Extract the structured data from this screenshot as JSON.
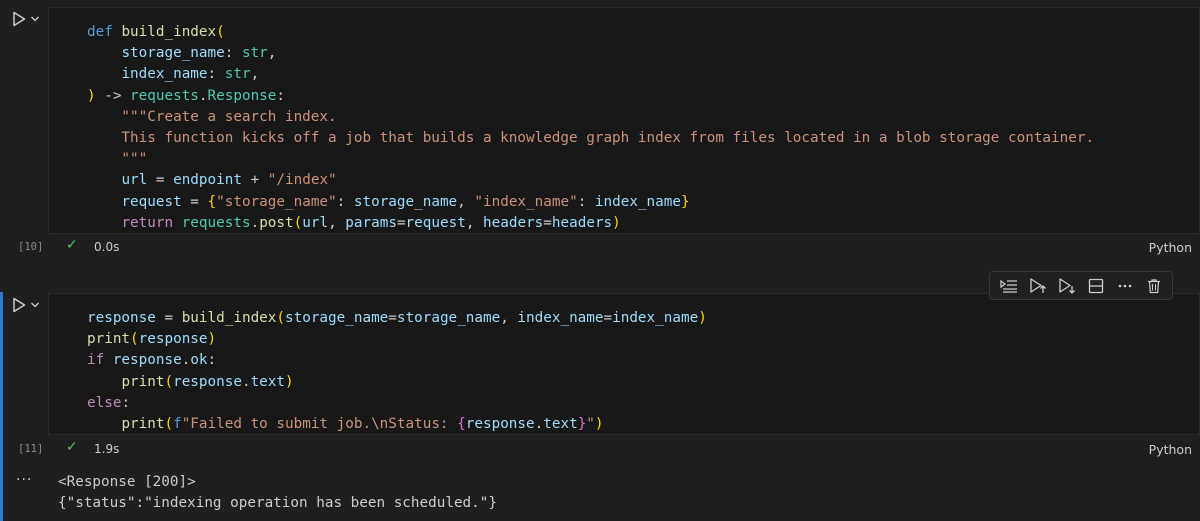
{
  "theme": {
    "background": "#1f1f1f",
    "editor_background": "#181818",
    "active_bar": "#2f7bd8",
    "success": "#4ec94e"
  },
  "cells": [
    {
      "execution_count": "[10]",
      "status_icon": "check-icon",
      "duration": "0.0s",
      "language": "Python",
      "code_lines": [
        [
          {
            "t": "def",
            "c": "kw"
          },
          {
            "t": " ",
            "c": "op"
          },
          {
            "t": "build_index",
            "c": "fn"
          },
          {
            "t": "(",
            "c": "p1"
          }
        ],
        [
          {
            "t": "    ",
            "c": "op"
          },
          {
            "t": "storage_name",
            "c": "var"
          },
          {
            "t": ": ",
            "c": "op"
          },
          {
            "t": "str",
            "c": "typ"
          },
          {
            "t": ",",
            "c": "op"
          }
        ],
        [
          {
            "t": "    ",
            "c": "op"
          },
          {
            "t": "index_name",
            "c": "var"
          },
          {
            "t": ": ",
            "c": "op"
          },
          {
            "t": "str",
            "c": "typ"
          },
          {
            "t": ",",
            "c": "op"
          }
        ],
        [
          {
            "t": ")",
            "c": "p1"
          },
          {
            "t": " -> ",
            "c": "op"
          },
          {
            "t": "requests",
            "c": "typ"
          },
          {
            "t": ".",
            "c": "op"
          },
          {
            "t": "Response",
            "c": "typ"
          },
          {
            "t": ":",
            "c": "op"
          }
        ],
        [
          {
            "t": "    \"\"\"Create a search index.",
            "c": "str"
          }
        ],
        [
          {
            "t": "    This function kicks off a job that builds a knowledge graph index from files located in a blob storage container.",
            "c": "str"
          }
        ],
        [
          {
            "t": "    \"\"\"",
            "c": "str"
          }
        ],
        [
          {
            "t": "    ",
            "c": "op"
          },
          {
            "t": "url",
            "c": "var"
          },
          {
            "t": " = ",
            "c": "op"
          },
          {
            "t": "endpoint",
            "c": "var"
          },
          {
            "t": " + ",
            "c": "op"
          },
          {
            "t": "\"/index\"",
            "c": "str"
          }
        ],
        [
          {
            "t": "    ",
            "c": "op"
          },
          {
            "t": "request",
            "c": "var"
          },
          {
            "t": " = ",
            "c": "op"
          },
          {
            "t": "{",
            "c": "p1"
          },
          {
            "t": "\"storage_name\"",
            "c": "str"
          },
          {
            "t": ": ",
            "c": "op"
          },
          {
            "t": "storage_name",
            "c": "var"
          },
          {
            "t": ", ",
            "c": "op"
          },
          {
            "t": "\"index_name\"",
            "c": "str"
          },
          {
            "t": ": ",
            "c": "op"
          },
          {
            "t": "index_name",
            "c": "var"
          },
          {
            "t": "}",
            "c": "p1"
          }
        ],
        [
          {
            "t": "    ",
            "c": "op"
          },
          {
            "t": "return",
            "c": "ctrl"
          },
          {
            "t": " ",
            "c": "op"
          },
          {
            "t": "requests",
            "c": "typ"
          },
          {
            "t": ".",
            "c": "op"
          },
          {
            "t": "post",
            "c": "fn"
          },
          {
            "t": "(",
            "c": "p1"
          },
          {
            "t": "url",
            "c": "var"
          },
          {
            "t": ", ",
            "c": "op"
          },
          {
            "t": "params",
            "c": "var"
          },
          {
            "t": "=",
            "c": "op"
          },
          {
            "t": "request",
            "c": "var"
          },
          {
            "t": ", ",
            "c": "op"
          },
          {
            "t": "headers",
            "c": "var"
          },
          {
            "t": "=",
            "c": "op"
          },
          {
            "t": "headers",
            "c": "var"
          },
          {
            "t": ")",
            "c": "p1"
          }
        ]
      ]
    },
    {
      "execution_count": "[11]",
      "status_icon": "check-icon",
      "duration": "1.9s",
      "language": "Python",
      "code_lines": [
        [
          {
            "t": "response",
            "c": "var"
          },
          {
            "t": " = ",
            "c": "op"
          },
          {
            "t": "build_index",
            "c": "fn"
          },
          {
            "t": "(",
            "c": "p1"
          },
          {
            "t": "storage_name",
            "c": "var"
          },
          {
            "t": "=",
            "c": "op"
          },
          {
            "t": "storage_name",
            "c": "var"
          },
          {
            "t": ", ",
            "c": "op"
          },
          {
            "t": "index_name",
            "c": "var"
          },
          {
            "t": "=",
            "c": "op"
          },
          {
            "t": "index_name",
            "c": "var"
          },
          {
            "t": ")",
            "c": "p1"
          }
        ],
        [
          {
            "t": "print",
            "c": "fn"
          },
          {
            "t": "(",
            "c": "p1"
          },
          {
            "t": "response",
            "c": "var"
          },
          {
            "t": ")",
            "c": "p1"
          }
        ],
        [
          {
            "t": "if",
            "c": "ctrl"
          },
          {
            "t": " ",
            "c": "op"
          },
          {
            "t": "response",
            "c": "var"
          },
          {
            "t": ".",
            "c": "op"
          },
          {
            "t": "ok",
            "c": "var"
          },
          {
            "t": ":",
            "c": "op"
          }
        ],
        [
          {
            "t": "    ",
            "c": "op"
          },
          {
            "t": "print",
            "c": "fn"
          },
          {
            "t": "(",
            "c": "p1"
          },
          {
            "t": "response",
            "c": "var"
          },
          {
            "t": ".",
            "c": "op"
          },
          {
            "t": "text",
            "c": "var"
          },
          {
            "t": ")",
            "c": "p1"
          }
        ],
        [
          {
            "t": "else",
            "c": "ctrl"
          },
          {
            "t": ":",
            "c": "op"
          }
        ],
        [
          {
            "t": "    ",
            "c": "op"
          },
          {
            "t": "print",
            "c": "fn"
          },
          {
            "t": "(",
            "c": "p1"
          },
          {
            "t": "f",
            "c": "fpre"
          },
          {
            "t": "\"Failed to submit job.\\nStatus: ",
            "c": "str"
          },
          {
            "t": "{",
            "c": "p2"
          },
          {
            "t": "response",
            "c": "var"
          },
          {
            "t": ".",
            "c": "op"
          },
          {
            "t": "text",
            "c": "var"
          },
          {
            "t": "}",
            "c": "p2"
          },
          {
            "t": "\"",
            "c": "str"
          },
          {
            "t": ")",
            "c": "p1"
          }
        ]
      ],
      "output_lines": [
        "<Response [200]>",
        "{\"status\":\"indexing operation has been scheduled.\"}"
      ]
    }
  ],
  "toolbar": {
    "items": [
      {
        "icon": "run-by-line-icon"
      },
      {
        "icon": "execute-above-icon"
      },
      {
        "icon": "execute-below-icon"
      },
      {
        "icon": "split-cell-icon"
      },
      {
        "icon": "more-actions-icon"
      },
      {
        "icon": "delete-icon"
      }
    ]
  },
  "output_more_label": "···"
}
